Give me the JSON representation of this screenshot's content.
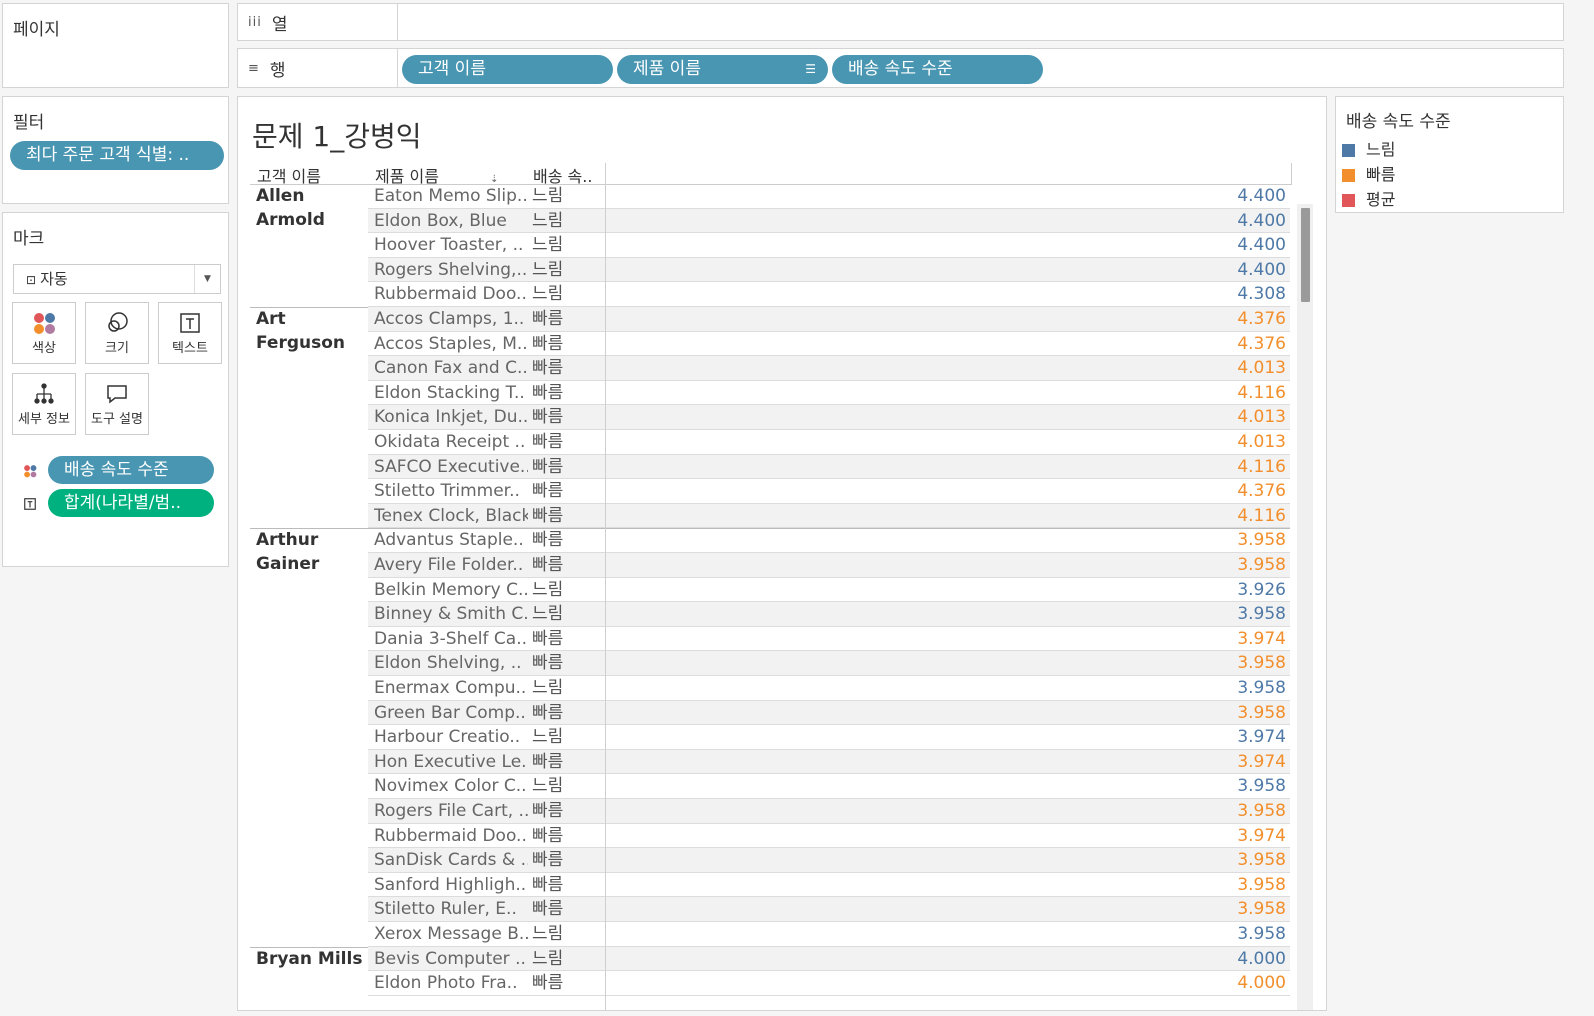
{
  "pages_panel": {
    "title": "페이지"
  },
  "filters_panel": {
    "title": "필터",
    "filter_pill": "최다 주문 고객 식별: .."
  },
  "marks_panel": {
    "title": "마크",
    "mark_type": "자동",
    "buttons": {
      "color": "색상",
      "size": "크기",
      "text": "텍스트",
      "detail": "세부 정보",
      "tooltip": "도구 설명"
    },
    "color_pill": "배송 속도 수준",
    "text_pill": "합계(나라별/범.."
  },
  "columns_shelf": {
    "glyph": "iii",
    "label": "열"
  },
  "rows_shelf": {
    "glyph": "≡",
    "label": "행",
    "pills": [
      "고객 이름",
      "제품 이름",
      "배송 속도 수준"
    ]
  },
  "viz": {
    "title": "문제 1_강병익",
    "col_customer": "고객 이름",
    "col_product": "제품 이름",
    "col_speed": "배송 속..",
    "groups": [
      {
        "customer": "Allen Armold",
        "rows": [
          {
            "product": "Eaton Memo Slip..",
            "speed": "느림",
            "value": "4.400"
          },
          {
            "product": "Eldon Box, Blue",
            "speed": "느림",
            "value": "4.400"
          },
          {
            "product": "Hoover Toaster, ..",
            "speed": "느림",
            "value": "4.400"
          },
          {
            "product": "Rogers Shelving,..",
            "speed": "느림",
            "value": "4.400"
          },
          {
            "product": "Rubbermaid Doo..",
            "speed": "느림",
            "value": "4.308"
          }
        ]
      },
      {
        "customer": "Art Ferguson",
        "rows": [
          {
            "product": "Accos Clamps, 1..",
            "speed": "빠름",
            "value": "4.376"
          },
          {
            "product": "Accos Staples, M..",
            "speed": "빠름",
            "value": "4.376"
          },
          {
            "product": "Canon Fax and C..",
            "speed": "빠름",
            "value": "4.013"
          },
          {
            "product": "Eldon Stacking T..",
            "speed": "빠름",
            "value": "4.116"
          },
          {
            "product": "Konica Inkjet, Du..",
            "speed": "빠름",
            "value": "4.013"
          },
          {
            "product": "Okidata Receipt ..",
            "speed": "빠름",
            "value": "4.013"
          },
          {
            "product": "SAFCO Executive..",
            "speed": "빠름",
            "value": "4.116"
          },
          {
            "product": "Stiletto Trimmer..",
            "speed": "빠름",
            "value": "4.376"
          },
          {
            "product": "Tenex Clock, Black",
            "speed": "빠름",
            "value": "4.116"
          }
        ]
      },
      {
        "customer": "Arthur Gainer",
        "rows": [
          {
            "product": "Advantus Staple..",
            "speed": "빠름",
            "value": "3.958"
          },
          {
            "product": "Avery File Folder..",
            "speed": "빠름",
            "value": "3.958"
          },
          {
            "product": "Belkin Memory C..",
            "speed": "느림",
            "value": "3.926"
          },
          {
            "product": "Binney & Smith C..",
            "speed": "느림",
            "value": "3.958"
          },
          {
            "product": "Dania 3-Shelf Ca..",
            "speed": "빠름",
            "value": "3.974"
          },
          {
            "product": "Eldon Shelving, ..",
            "speed": "빠름",
            "value": "3.958"
          },
          {
            "product": "Enermax Compu..",
            "speed": "느림",
            "value": "3.958"
          },
          {
            "product": "Green Bar Comp..",
            "speed": "빠름",
            "value": "3.958"
          },
          {
            "product": "Harbour Creatio..",
            "speed": "느림",
            "value": "3.974"
          },
          {
            "product": "Hon Executive Le..",
            "speed": "빠름",
            "value": "3.974"
          },
          {
            "product": "Novimex Color C..",
            "speed": "느림",
            "value": "3.958"
          },
          {
            "product": "Rogers File Cart, ..",
            "speed": "빠름",
            "value": "3.958"
          },
          {
            "product": "Rubbermaid Doo..",
            "speed": "빠름",
            "value": "3.974"
          },
          {
            "product": "SanDisk Cards & ..",
            "speed": "빠름",
            "value": "3.958"
          },
          {
            "product": "Sanford Highligh..",
            "speed": "빠름",
            "value": "3.958"
          },
          {
            "product": "Stiletto Ruler, E..",
            "speed": "빠름",
            "value": "3.958"
          },
          {
            "product": "Xerox Message B..",
            "speed": "느림",
            "value": "3.958"
          }
        ]
      },
      {
        "customer": "Bryan Mills",
        "rows": [
          {
            "product": "Bevis Computer ..",
            "speed": "느림",
            "value": "4.000"
          },
          {
            "product": "Eldon Photo Fra..",
            "speed": "빠름",
            "value": "4.000"
          }
        ]
      }
    ]
  },
  "legend": {
    "title": "배송 속도 수준",
    "items": [
      {
        "label": "느림",
        "color": "#4e79a7"
      },
      {
        "label": "빠름",
        "color": "#f28e2b"
      },
      {
        "label": "평균",
        "color": "#e15759"
      }
    ]
  },
  "colors": {
    "slow": "#4e79a7",
    "fast": "#f28e2b",
    "pill_blue": "#4996b2",
    "pill_green": "#00b180"
  }
}
